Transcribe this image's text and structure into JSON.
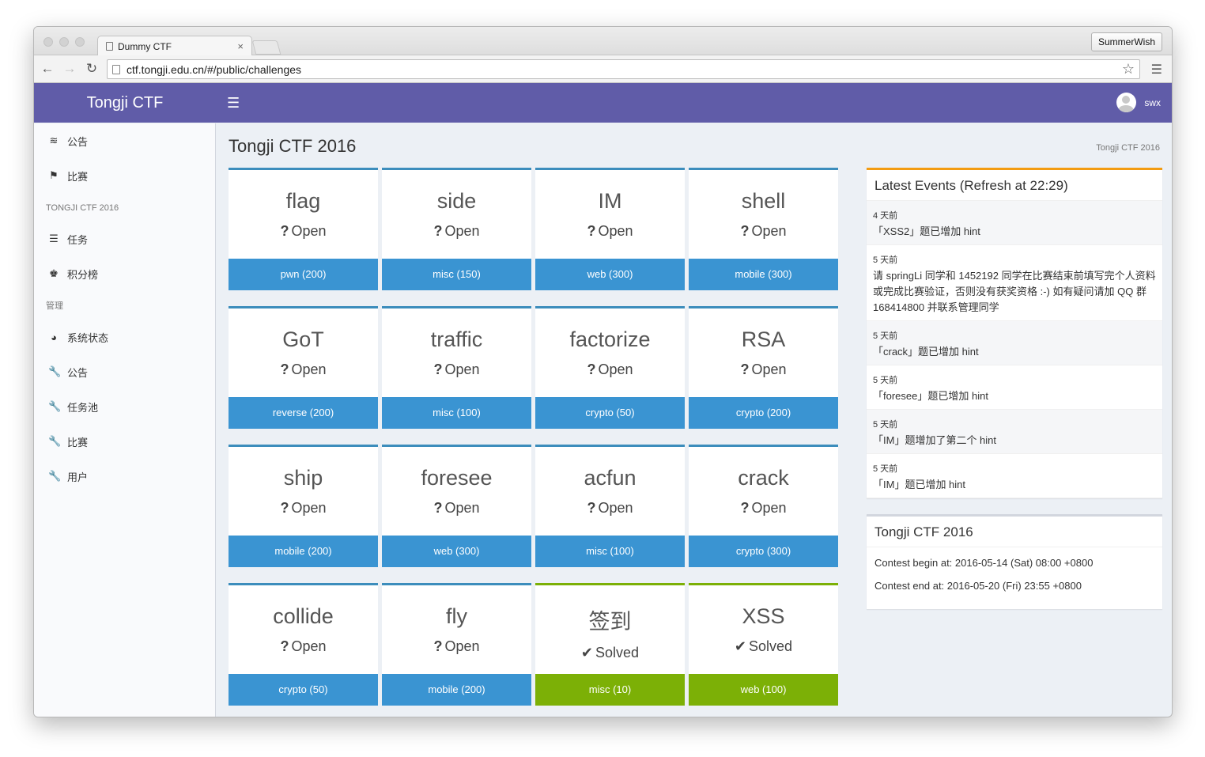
{
  "browser": {
    "tab_title": "Dummy CTF",
    "tab_close": "×",
    "profile_name": "SummerWish",
    "url": "ctf.tongji.edu.cn/#/public/challenges"
  },
  "header": {
    "logo": "Tongji CTF",
    "username": "swx"
  },
  "sidebar": {
    "items_top": [
      {
        "icon": "rss-icon",
        "label": "公告"
      },
      {
        "icon": "flag-icon",
        "label": "比赛"
      }
    ],
    "section1": "TONGJI CTF 2016",
    "items_mid": [
      {
        "icon": "list-icon",
        "label": "任务"
      },
      {
        "icon": "trophy-icon",
        "label": "积分榜"
      }
    ],
    "section2": "管理",
    "items_admin": [
      {
        "icon": "dashboard-icon",
        "label": "系统状态"
      },
      {
        "icon": "wrench-icon",
        "label": "公告"
      },
      {
        "icon": "wrench-icon",
        "label": "任务池"
      },
      {
        "icon": "wrench-icon",
        "label": "比赛"
      },
      {
        "icon": "wrench-icon",
        "label": "用户"
      }
    ]
  },
  "main": {
    "title": "Tongji CTF 2016",
    "breadcrumb": "Tongji CTF 2016",
    "challenges": [
      {
        "name": "flag",
        "status": "Open",
        "footer": "pwn (200)",
        "solved": false
      },
      {
        "name": "side",
        "status": "Open",
        "footer": "misc (150)",
        "solved": false
      },
      {
        "name": "IM",
        "status": "Open",
        "footer": "web (300)",
        "solved": false
      },
      {
        "name": "shell",
        "status": "Open",
        "footer": "mobile (300)",
        "solved": false
      },
      {
        "name": "GoT",
        "status": "Open",
        "footer": "reverse (200)",
        "solved": false
      },
      {
        "name": "traffic",
        "status": "Open",
        "footer": "misc (100)",
        "solved": false
      },
      {
        "name": "factorize",
        "status": "Open",
        "footer": "crypto (50)",
        "solved": false
      },
      {
        "name": "RSA",
        "status": "Open",
        "footer": "crypto (200)",
        "solved": false
      },
      {
        "name": "ship",
        "status": "Open",
        "footer": "mobile (200)",
        "solved": false
      },
      {
        "name": "foresee",
        "status": "Open",
        "footer": "web (300)",
        "solved": false
      },
      {
        "name": "acfun",
        "status": "Open",
        "footer": "misc (100)",
        "solved": false
      },
      {
        "name": "crack",
        "status": "Open",
        "footer": "crypto (300)",
        "solved": false
      },
      {
        "name": "collide",
        "status": "Open",
        "footer": "crypto (50)",
        "solved": false
      },
      {
        "name": "fly",
        "status": "Open",
        "footer": "mobile (200)",
        "solved": false
      },
      {
        "name": "签到",
        "status": "Solved",
        "footer": "misc (10)",
        "solved": true
      },
      {
        "name": "XSS",
        "status": "Solved",
        "footer": "web (100)",
        "solved": true
      }
    ]
  },
  "events": {
    "title": "Latest Events (Refresh at 22:29)",
    "items": [
      {
        "time": "4 天前",
        "text": "「XSS2」题已增加 hint"
      },
      {
        "time": "5 天前",
        "text": "请 springLi 同学和 1452192 同学在比赛结束前填写完个人资料或完成比赛验证，否则没有获奖资格 :-) 如有疑问请加 QQ 群 168414800 并联系管理同学"
      },
      {
        "time": "5 天前",
        "text": "「crack」题已增加 hint"
      },
      {
        "time": "5 天前",
        "text": "「foresee」题已增加 hint"
      },
      {
        "time": "5 天前",
        "text": "「IM」题增加了第二个 hint"
      },
      {
        "time": "5 天前",
        "text": "「IM」题已增加 hint"
      }
    ]
  },
  "contest": {
    "title": "Tongji CTF 2016",
    "begin": "Contest begin at: 2016-05-14 (Sat) 08:00 +0800",
    "end": "Contest end at: 2016-05-20 (Fri) 23:55 +0800"
  },
  "colors": {
    "header": "#605ca8",
    "card_open": "#3a94d2",
    "card_solved": "#7cb006",
    "events_accent": "#f39c12"
  }
}
